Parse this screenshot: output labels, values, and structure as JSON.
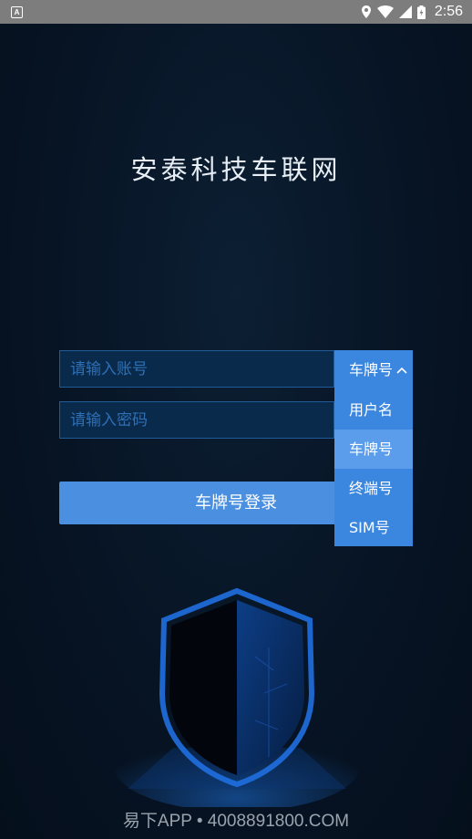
{
  "status_bar": {
    "time": "2:56",
    "icons": [
      "app-notification-icon",
      "location-icon",
      "wifi-icon",
      "cell-signal-icon",
      "battery-icon"
    ]
  },
  "app": {
    "title": "安泰科技车联网"
  },
  "form": {
    "account_placeholder": "请输入账号",
    "password_placeholder": "请输入密码",
    "login_button": "车牌号登录"
  },
  "dropdown": {
    "selected": "车牌号",
    "options": [
      "用户名",
      "车牌号",
      "终端号",
      "SIM号"
    ]
  },
  "footer": {
    "watermark": "易下APP • 4008891800.COM"
  },
  "colors": {
    "accent": "#3b86de",
    "button": "#4a8fe0",
    "input_bg": "#0a2a4c",
    "background": "#071424"
  }
}
